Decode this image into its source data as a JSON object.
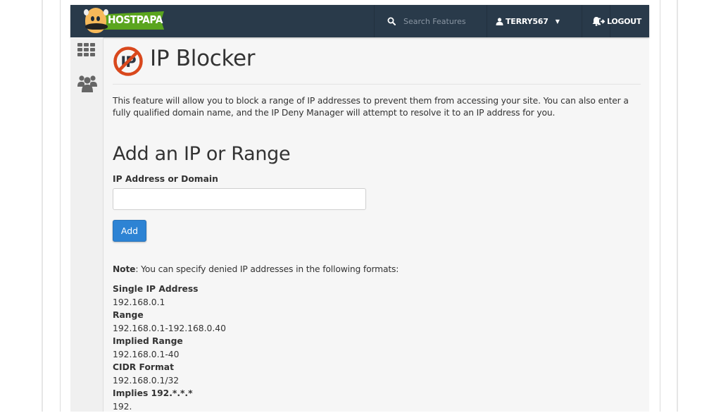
{
  "header": {
    "logo_text": "HOSTPAPA",
    "search_placeholder": "Search Features",
    "username": "TERRY567",
    "logout_label": "LOGOUT",
    "icons": {
      "search": "search-icon",
      "user": "user-icon",
      "caret": "caret-down-icon",
      "bell": "bell-icon",
      "logout": "logout-icon"
    }
  },
  "sidebar": {
    "items": [
      {
        "icon": "apps-grid-icon",
        "label": ""
      },
      {
        "icon": "users-icon",
        "label": ""
      }
    ]
  },
  "page": {
    "title": "IP Blocker",
    "title_icon": "ip-blocked-icon",
    "description": "This feature will allow you to block a range of IP addresses to prevent them from accessing your site. You can also enter a fully qualified domain name, and the IP Deny Manager will attempt to resolve it to an IP address for you.",
    "section_title": "Add an IP or Range",
    "field_label": "IP Address or Domain",
    "field_value": "",
    "add_button": "Add",
    "note_label": "Note",
    "note_text": ": You can specify denied IP addresses in the following formats:",
    "formats": [
      {
        "name": "Single IP Address",
        "example": "192.168.0.1"
      },
      {
        "name": "Range",
        "example": "192.168.0.1-192.168.0.40"
      },
      {
        "name": "Implied Range",
        "example": "192.168.0.1-40"
      },
      {
        "name": "CIDR Format",
        "example": "192.168.0.1/32"
      },
      {
        "name": "Implies 192.*.*.*",
        "example": "192."
      }
    ]
  },
  "colors": {
    "topbar": "#293a4a",
    "primary_button": "#2d83d4",
    "logo_green": "#5aa51e",
    "block_icon_red": "#d9481d"
  }
}
